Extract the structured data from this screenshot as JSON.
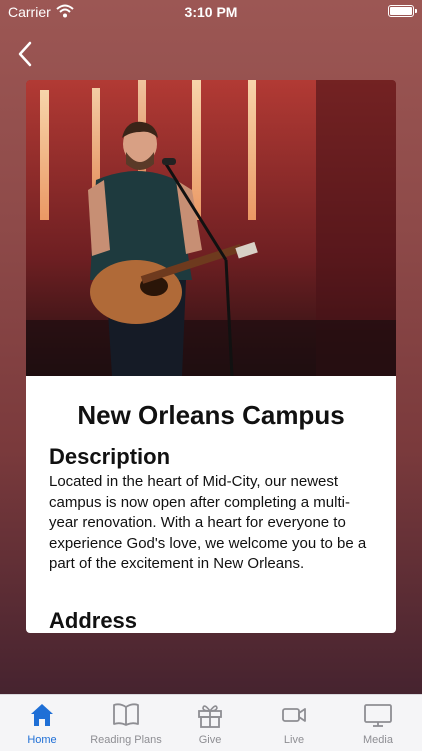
{
  "status_bar": {
    "carrier": "Carrier",
    "time": "3:10 PM"
  },
  "campus": {
    "title": "New Orleans Campus",
    "description_heading": "Description",
    "description": "Located in the heart of Mid-City, our newest campus is now open after completing a multi-year renovation. With a heart for everyone to experience God's love, we welcome you to be a part of the excitement in New Orleans.",
    "address_heading": "Address"
  },
  "tabs": [
    {
      "label": "Home",
      "icon": "home-icon",
      "active": true
    },
    {
      "label": "Reading Plans",
      "icon": "book-icon",
      "active": false
    },
    {
      "label": "Give",
      "icon": "gift-icon",
      "active": false
    },
    {
      "label": "Live",
      "icon": "video-camera-icon",
      "active": false
    },
    {
      "label": "Media",
      "icon": "monitor-icon",
      "active": false
    }
  ],
  "colors": {
    "accent": "#1f6fd6",
    "inactive_tab": "#8e8e93",
    "background_top": "#9c5754",
    "background_bottom": "#3a1e2c"
  }
}
